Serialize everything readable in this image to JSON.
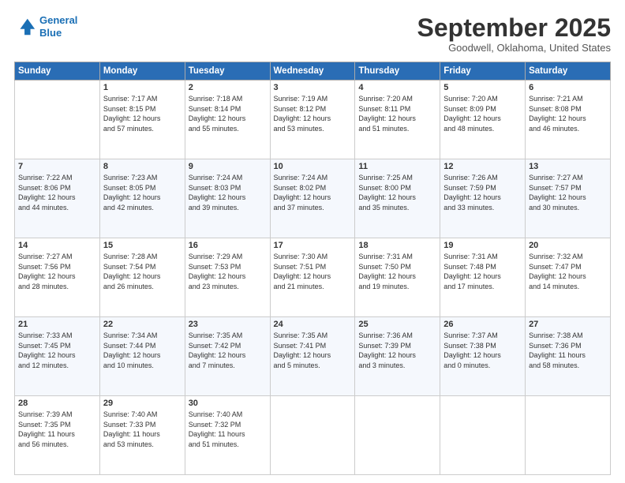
{
  "logo": {
    "line1": "General",
    "line2": "Blue"
  },
  "title": "September 2025",
  "location": "Goodwell, Oklahoma, United States",
  "days_of_week": [
    "Sunday",
    "Monday",
    "Tuesday",
    "Wednesday",
    "Thursday",
    "Friday",
    "Saturday"
  ],
  "weeks": [
    [
      {
        "day": "",
        "info": ""
      },
      {
        "day": "1",
        "info": "Sunrise: 7:17 AM\nSunset: 8:15 PM\nDaylight: 12 hours\nand 57 minutes."
      },
      {
        "day": "2",
        "info": "Sunrise: 7:18 AM\nSunset: 8:14 PM\nDaylight: 12 hours\nand 55 minutes."
      },
      {
        "day": "3",
        "info": "Sunrise: 7:19 AM\nSunset: 8:12 PM\nDaylight: 12 hours\nand 53 minutes."
      },
      {
        "day": "4",
        "info": "Sunrise: 7:20 AM\nSunset: 8:11 PM\nDaylight: 12 hours\nand 51 minutes."
      },
      {
        "day": "5",
        "info": "Sunrise: 7:20 AM\nSunset: 8:09 PM\nDaylight: 12 hours\nand 48 minutes."
      },
      {
        "day": "6",
        "info": "Sunrise: 7:21 AM\nSunset: 8:08 PM\nDaylight: 12 hours\nand 46 minutes."
      }
    ],
    [
      {
        "day": "7",
        "info": "Sunrise: 7:22 AM\nSunset: 8:06 PM\nDaylight: 12 hours\nand 44 minutes."
      },
      {
        "day": "8",
        "info": "Sunrise: 7:23 AM\nSunset: 8:05 PM\nDaylight: 12 hours\nand 42 minutes."
      },
      {
        "day": "9",
        "info": "Sunrise: 7:24 AM\nSunset: 8:03 PM\nDaylight: 12 hours\nand 39 minutes."
      },
      {
        "day": "10",
        "info": "Sunrise: 7:24 AM\nSunset: 8:02 PM\nDaylight: 12 hours\nand 37 minutes."
      },
      {
        "day": "11",
        "info": "Sunrise: 7:25 AM\nSunset: 8:00 PM\nDaylight: 12 hours\nand 35 minutes."
      },
      {
        "day": "12",
        "info": "Sunrise: 7:26 AM\nSunset: 7:59 PM\nDaylight: 12 hours\nand 33 minutes."
      },
      {
        "day": "13",
        "info": "Sunrise: 7:27 AM\nSunset: 7:57 PM\nDaylight: 12 hours\nand 30 minutes."
      }
    ],
    [
      {
        "day": "14",
        "info": "Sunrise: 7:27 AM\nSunset: 7:56 PM\nDaylight: 12 hours\nand 28 minutes."
      },
      {
        "day": "15",
        "info": "Sunrise: 7:28 AM\nSunset: 7:54 PM\nDaylight: 12 hours\nand 26 minutes."
      },
      {
        "day": "16",
        "info": "Sunrise: 7:29 AM\nSunset: 7:53 PM\nDaylight: 12 hours\nand 23 minutes."
      },
      {
        "day": "17",
        "info": "Sunrise: 7:30 AM\nSunset: 7:51 PM\nDaylight: 12 hours\nand 21 minutes."
      },
      {
        "day": "18",
        "info": "Sunrise: 7:31 AM\nSunset: 7:50 PM\nDaylight: 12 hours\nand 19 minutes."
      },
      {
        "day": "19",
        "info": "Sunrise: 7:31 AM\nSunset: 7:48 PM\nDaylight: 12 hours\nand 17 minutes."
      },
      {
        "day": "20",
        "info": "Sunrise: 7:32 AM\nSunset: 7:47 PM\nDaylight: 12 hours\nand 14 minutes."
      }
    ],
    [
      {
        "day": "21",
        "info": "Sunrise: 7:33 AM\nSunset: 7:45 PM\nDaylight: 12 hours\nand 12 minutes."
      },
      {
        "day": "22",
        "info": "Sunrise: 7:34 AM\nSunset: 7:44 PM\nDaylight: 12 hours\nand 10 minutes."
      },
      {
        "day": "23",
        "info": "Sunrise: 7:35 AM\nSunset: 7:42 PM\nDaylight: 12 hours\nand 7 minutes."
      },
      {
        "day": "24",
        "info": "Sunrise: 7:35 AM\nSunset: 7:41 PM\nDaylight: 12 hours\nand 5 minutes."
      },
      {
        "day": "25",
        "info": "Sunrise: 7:36 AM\nSunset: 7:39 PM\nDaylight: 12 hours\nand 3 minutes."
      },
      {
        "day": "26",
        "info": "Sunrise: 7:37 AM\nSunset: 7:38 PM\nDaylight: 12 hours\nand 0 minutes."
      },
      {
        "day": "27",
        "info": "Sunrise: 7:38 AM\nSunset: 7:36 PM\nDaylight: 11 hours\nand 58 minutes."
      }
    ],
    [
      {
        "day": "28",
        "info": "Sunrise: 7:39 AM\nSunset: 7:35 PM\nDaylight: 11 hours\nand 56 minutes."
      },
      {
        "day": "29",
        "info": "Sunrise: 7:40 AM\nSunset: 7:33 PM\nDaylight: 11 hours\nand 53 minutes."
      },
      {
        "day": "30",
        "info": "Sunrise: 7:40 AM\nSunset: 7:32 PM\nDaylight: 11 hours\nand 51 minutes."
      },
      {
        "day": "",
        "info": ""
      },
      {
        "day": "",
        "info": ""
      },
      {
        "day": "",
        "info": ""
      },
      {
        "day": "",
        "info": ""
      }
    ]
  ]
}
